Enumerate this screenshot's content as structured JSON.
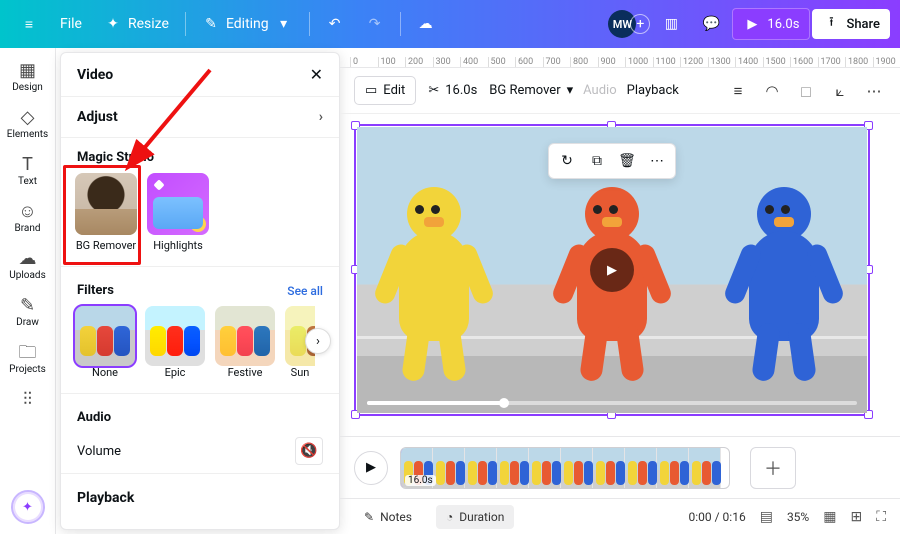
{
  "topbar": {
    "file": "File",
    "resize": "Resize",
    "editing": "Editing",
    "duration": "16.0s",
    "share": "Share",
    "avatar": "MW"
  },
  "leftrail": {
    "items": [
      {
        "label": "Design",
        "icon": "▦"
      },
      {
        "label": "Elements",
        "icon": "◇"
      },
      {
        "label": "Text",
        "icon": "T"
      },
      {
        "label": "Brand",
        "icon": "☺"
      },
      {
        "label": "Uploads",
        "icon": "☁"
      },
      {
        "label": "Draw",
        "icon": "✎"
      },
      {
        "label": "Projects",
        "icon": "🗀"
      },
      {
        "label": "",
        "icon": "⫶⫶"
      }
    ]
  },
  "sidepanel": {
    "title": "Video",
    "adjust": "Adjust",
    "magic_title": "Magic Studio",
    "magic_cards": [
      {
        "label": "BG Remover"
      },
      {
        "label": "Highlights"
      }
    ],
    "filters_title": "Filters",
    "see_all": "See all",
    "filters": [
      {
        "label": "None"
      },
      {
        "label": "Epic"
      },
      {
        "label": "Festive"
      },
      {
        "label": "Sun"
      }
    ],
    "audio": "Audio",
    "volume": "Volume",
    "playback": "Playback"
  },
  "canvas_toolbar": {
    "edit": "Edit",
    "clip_len": "16.0s",
    "bg_remover": "BG Remover",
    "audio": "Audio",
    "playback": "Playback"
  },
  "ruler_ticks": [
    "0",
    "100",
    "200",
    "300",
    "400",
    "500",
    "600",
    "700",
    "800",
    "900",
    "1000",
    "1100",
    "1200",
    "1300",
    "1400",
    "1500",
    "1600",
    "1700",
    "1800",
    "1900"
  ],
  "timeline": {
    "clip_len": "16.0s"
  },
  "bottombar": {
    "notes": "Notes",
    "duration": "Duration",
    "time": "0:00 / 0:16",
    "zoom": "35%"
  }
}
